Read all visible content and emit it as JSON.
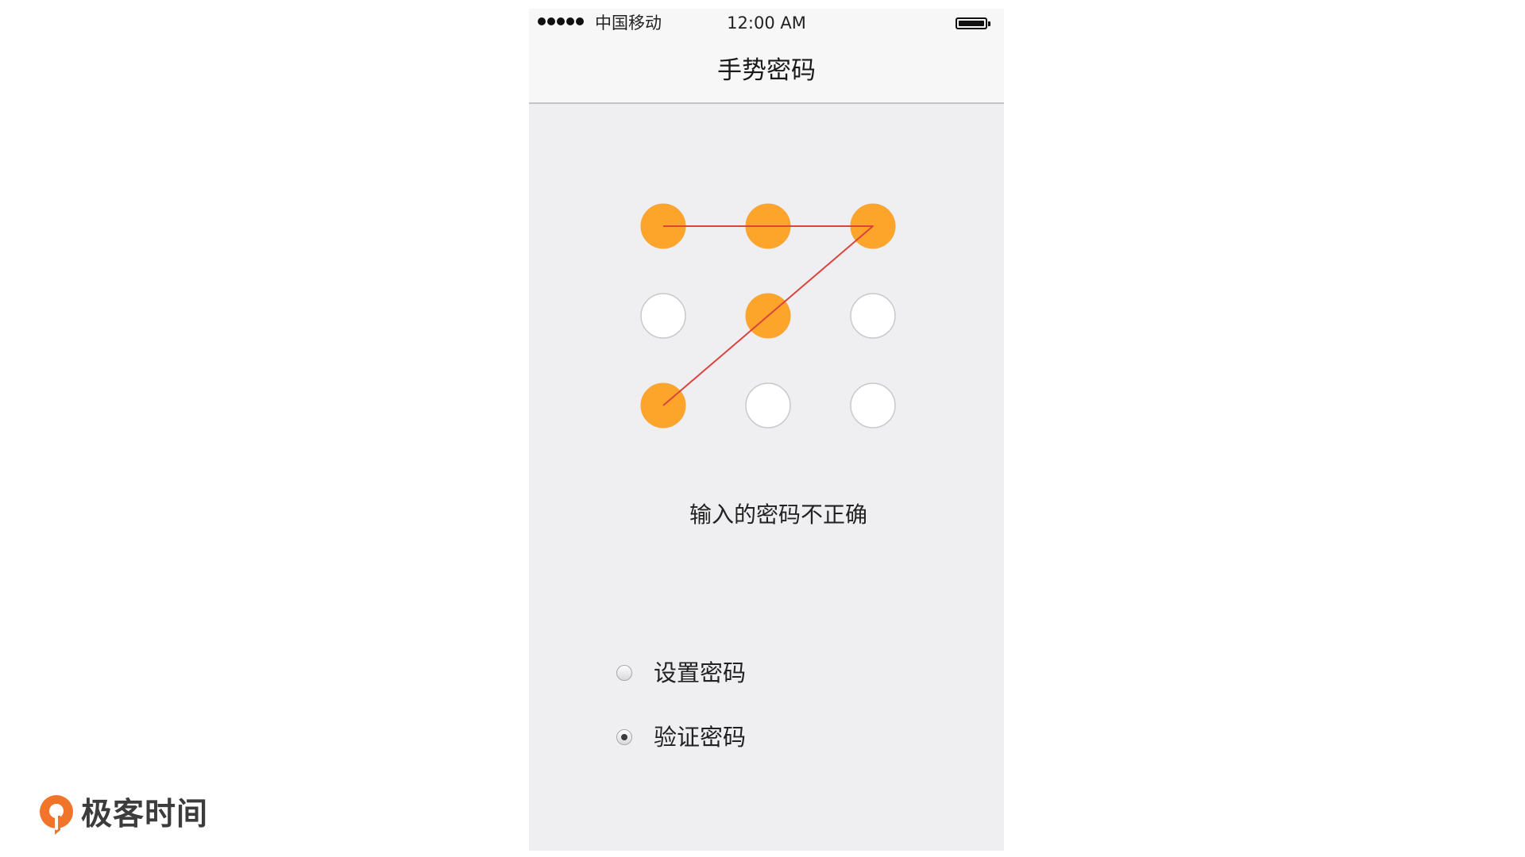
{
  "status_bar": {
    "carrier": "中国移动",
    "time": "12:00 AM",
    "signal_bars": 5,
    "battery_icon": "battery-full-icon"
  },
  "nav": {
    "title": "手势密码"
  },
  "pattern_lock": {
    "grid": [
      {
        "row": 1,
        "col": 1,
        "selected": true
      },
      {
        "row": 1,
        "col": 2,
        "selected": true
      },
      {
        "row": 1,
        "col": 3,
        "selected": true
      },
      {
        "row": 2,
        "col": 1,
        "selected": false
      },
      {
        "row": 2,
        "col": 2,
        "selected": true
      },
      {
        "row": 2,
        "col": 3,
        "selected": false
      },
      {
        "row": 3,
        "col": 1,
        "selected": true
      },
      {
        "row": 3,
        "col": 2,
        "selected": false
      },
      {
        "row": 3,
        "col": 3,
        "selected": false
      }
    ],
    "path_order": [
      1,
      2,
      3,
      5,
      7
    ],
    "selected_color": "#fda42a",
    "line_color": "#d9453c",
    "message": "输入的密码不正确"
  },
  "mode": {
    "options": [
      {
        "label": "设置密码",
        "selected": false
      },
      {
        "label": "验证密码",
        "selected": true
      }
    ]
  },
  "brand": {
    "name": "极客时间",
    "accent": "#f0752b"
  }
}
